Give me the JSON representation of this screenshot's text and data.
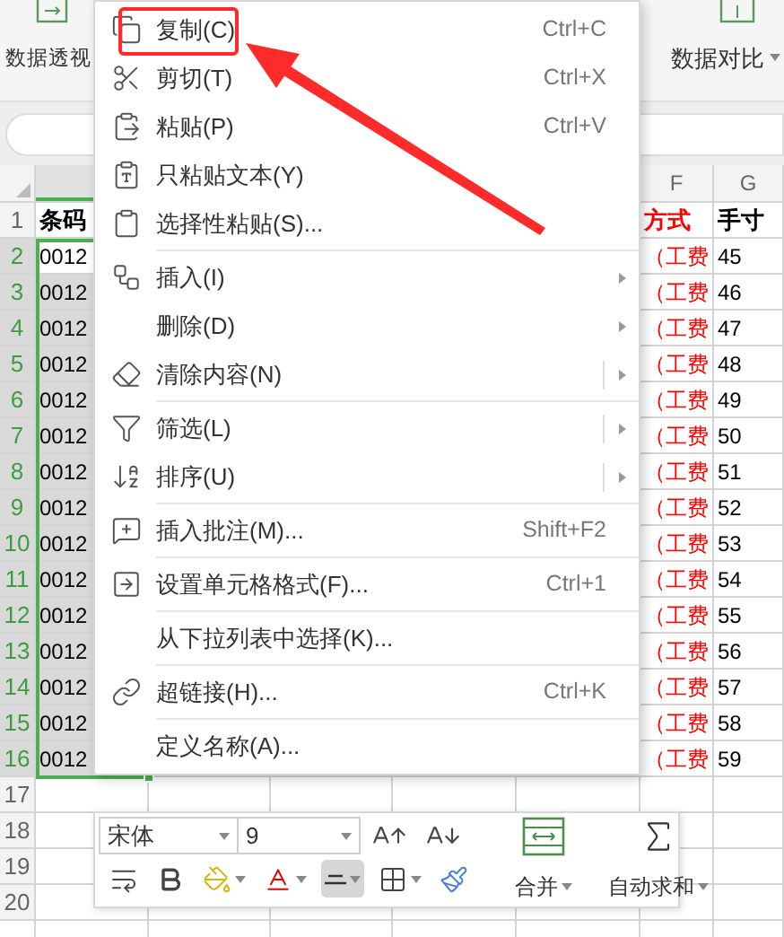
{
  "ribbon": {
    "left_label": "数据透视",
    "right_label": "数据对比"
  },
  "column_headers": [
    {
      "selected": true
    },
    {
      "label": "F",
      "selected": false
    },
    {
      "label": "G",
      "selected": false
    }
  ],
  "rows": [
    {
      "number": "1",
      "selected": false,
      "cells": [
        "条码",
        "方式",
        "手寸"
      ]
    },
    {
      "number": "2",
      "selected": true,
      "cells": [
        "0012",
        "（工费",
        "45"
      ]
    },
    {
      "number": "3",
      "selected": true,
      "cells": [
        "0012",
        "（工费",
        "46"
      ]
    },
    {
      "number": "4",
      "selected": true,
      "cells": [
        "0012",
        "（工费",
        "47"
      ]
    },
    {
      "number": "5",
      "selected": true,
      "cells": [
        "0012",
        "（工费",
        "48"
      ]
    },
    {
      "number": "6",
      "selected": true,
      "cells": [
        "0012",
        "（工费",
        "49"
      ]
    },
    {
      "number": "7",
      "selected": true,
      "cells": [
        "0012",
        "（工费",
        "50"
      ]
    },
    {
      "number": "8",
      "selected": true,
      "cells": [
        "0012",
        "（工费",
        "51"
      ]
    },
    {
      "number": "9",
      "selected": true,
      "cells": [
        "0012",
        "（工费",
        "52"
      ]
    },
    {
      "number": "10",
      "selected": true,
      "cells": [
        "0012",
        "（工费",
        "53"
      ]
    },
    {
      "number": "11",
      "selected": true,
      "cells": [
        "0012",
        "（工费",
        "54"
      ]
    },
    {
      "number": "12",
      "selected": true,
      "cells": [
        "0012",
        "（工费",
        "55"
      ]
    },
    {
      "number": "13",
      "selected": true,
      "cells": [
        "0012",
        "（工费",
        "56"
      ]
    },
    {
      "number": "14",
      "selected": true,
      "cells": [
        "0012",
        "（工费",
        "57"
      ]
    },
    {
      "number": "15",
      "selected": true,
      "cells": [
        "0012",
        "（工费",
        "58"
      ]
    },
    {
      "number": "16",
      "selected": true,
      "cells": [
        "0012",
        "（工费",
        "59"
      ]
    },
    {
      "number": "17",
      "selected": false
    },
    {
      "number": "18",
      "selected": false
    },
    {
      "number": "19",
      "selected": false
    },
    {
      "number": "20",
      "selected": false
    }
  ],
  "context_menu": [
    {
      "label": "复制(C)",
      "shortcut": "Ctrl+C",
      "submenu": false,
      "split": false,
      "divider": false,
      "marked": true
    },
    {
      "label": "剪切(T)",
      "shortcut": "Ctrl+X",
      "submenu": false,
      "split": false,
      "divider": false,
      "marked": false
    },
    {
      "label": "粘贴(P)",
      "shortcut": "Ctrl+V",
      "submenu": false,
      "split": false,
      "divider": false,
      "marked": false
    },
    {
      "label": "只粘贴文本(Y)",
      "submenu": false,
      "split": false,
      "divider": false,
      "marked": false
    },
    {
      "label": "选择性粘贴(S)...",
      "submenu": false,
      "split": false,
      "divider": true,
      "marked": false
    },
    {
      "label": "插入(I)",
      "submenu": true,
      "split": false,
      "divider": false,
      "marked": false
    },
    {
      "label": "删除(D)",
      "submenu": true,
      "split": false,
      "divider": false,
      "marked": false
    },
    {
      "label": "清除内容(N)",
      "submenu": true,
      "split": true,
      "divider": true,
      "marked": false
    },
    {
      "label": "筛选(L)",
      "submenu": true,
      "split": true,
      "divider": false,
      "marked": false
    },
    {
      "label": "排序(U)",
      "submenu": true,
      "split": true,
      "divider": true,
      "marked": false
    },
    {
      "label": "插入批注(M)...",
      "shortcut": "Shift+F2",
      "submenu": false,
      "split": false,
      "divider": true,
      "marked": false
    },
    {
      "label": "设置单元格格式(F)...",
      "shortcut": "Ctrl+1",
      "submenu": false,
      "split": false,
      "divider": true,
      "marked": false
    },
    {
      "label": "从下拉列表中选择(K)...",
      "submenu": false,
      "split": false,
      "divider": true,
      "marked": false
    },
    {
      "label": "超链接(H)...",
      "shortcut": "Ctrl+K",
      "submenu": false,
      "split": false,
      "divider": true,
      "marked": false
    },
    {
      "label": "定义名称(A)...",
      "submenu": false,
      "split": false,
      "divider": false,
      "marked": false
    }
  ],
  "mini_toolbar": {
    "font": "宋体",
    "size": "9",
    "tools": [
      {
        "selected": false,
        "dropdown": false
      },
      {
        "selected": false,
        "dropdown": false
      },
      {
        "selected": false,
        "dropdown": true
      },
      {
        "selected": false,
        "dropdown": true
      },
      {
        "selected": true,
        "dropdown": true
      },
      {
        "selected": false,
        "dropdown": true
      },
      {
        "selected": false,
        "dropdown": false
      }
    ],
    "buttons": [
      {
        "label": "合并"
      },
      {
        "label": "自动求和"
      }
    ]
  }
}
